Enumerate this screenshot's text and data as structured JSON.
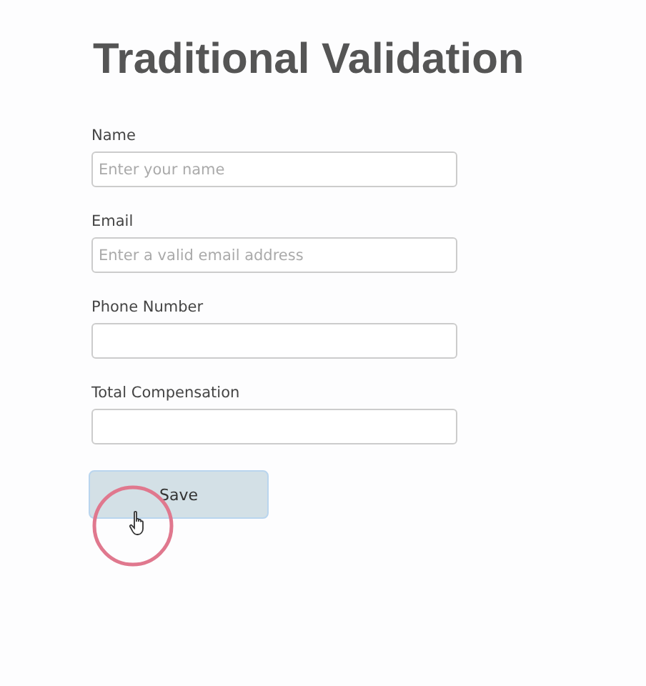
{
  "title": "Traditional Validation",
  "fields": [
    {
      "label": "Name",
      "placeholder": "Enter your name"
    },
    {
      "label": "Email",
      "placeholder": "Enter a valid email address"
    },
    {
      "label": "Phone Number"
    },
    {
      "label": "Total Compensation"
    }
  ],
  "button": {
    "label": "Save"
  }
}
